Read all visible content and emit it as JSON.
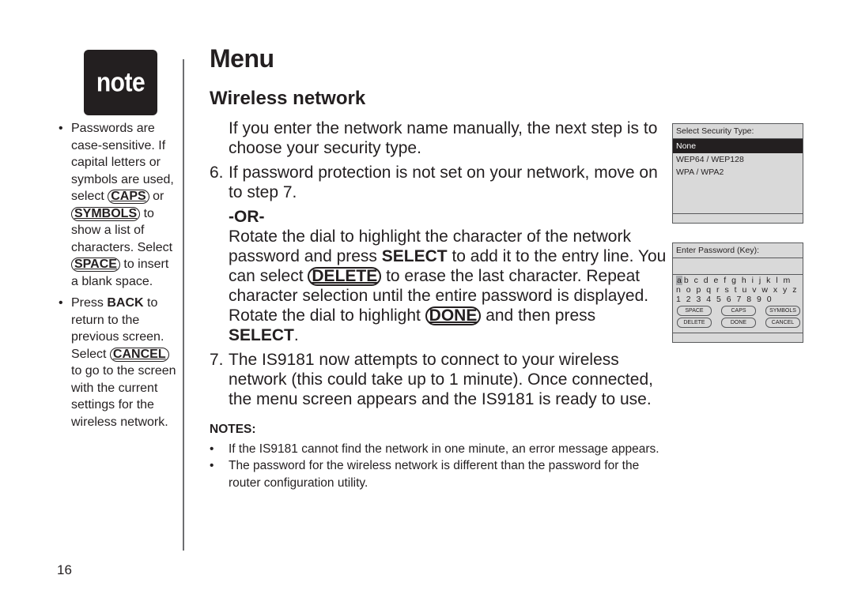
{
  "note_badge": {
    "label": "note"
  },
  "sidebar": {
    "items": [
      {
        "parts": [
          {
            "type": "text",
            "text": "Passwords are case-sensitive. If capital letters or symbols are used, select "
          },
          {
            "type": "key",
            "text": "CAPS"
          },
          {
            "type": "text",
            "text": " or "
          },
          {
            "type": "key",
            "text": "SYMBOLS"
          },
          {
            "type": "text",
            "text": " to show a list of characters. Select "
          },
          {
            "type": "key",
            "text": "SPACE"
          },
          {
            "type": "text",
            "text": " to insert a blank space."
          }
        ]
      },
      {
        "parts": [
          {
            "type": "text",
            "text": "Press "
          },
          {
            "type": "bold",
            "text": "BACK"
          },
          {
            "type": "text",
            "text": " to return to the previous screen. Select "
          },
          {
            "type": "key",
            "text": "CANCEL"
          },
          {
            "type": "text",
            "text": " to go to the screen with the current settings for the wireless network."
          }
        ]
      }
    ]
  },
  "page_number": "16",
  "main": {
    "title": "Menu",
    "subtitle": "Wireless network",
    "intro": "If you enter the network name manually, the next step is to choose your security type.",
    "step6": {
      "num": "6.",
      "text": "If password protection is not set on your network, move on to step 7."
    },
    "or_label": "-OR-",
    "rotate": {
      "t1": "Rotate the dial to highlight the character of the network password and press ",
      "b1": "SELECT",
      "t2": " to add it to the entry line. You can select ",
      "k1": "DELETE",
      "t3": " to erase the last character. Repeat character selection until the entire password is displayed. Rotate the dial to highlight ",
      "k2": "DONE",
      "t4": " and then press ",
      "b2": "SELECT",
      "t5": "."
    },
    "step7": {
      "num": "7.",
      "text": "The IS9181 now attempts to connect to your wireless network (this could take up to 1 minute). Once connected, the menu screen appears and the IS9181 is ready to use."
    },
    "notes": {
      "heading": "NOTES:",
      "items": [
        "If the IS9181 cannot find the network in one minute, an error message appears.",
        "The password for the wireless network is different than the password for the router configuration utility."
      ]
    }
  },
  "screens": {
    "security": {
      "title": "Select Security Type:",
      "selected": "None",
      "options": [
        "WEP64 / WEP128",
        "WPA / WPA2"
      ]
    },
    "password": {
      "title": "Enter Password (Key):",
      "input_value": "",
      "highlighted_char": "a",
      "row1": "b c d e f g h i j k l m",
      "row2": "n o p q r s t u v w x y z",
      "row3": "1 2 3 4 5 6 7 8 9 0",
      "buttons_row1": [
        "SPACE",
        "CAPS",
        "SYMBOLS"
      ],
      "buttons_row2": [
        "DELETE",
        "DONE",
        "CANCEL"
      ]
    }
  }
}
